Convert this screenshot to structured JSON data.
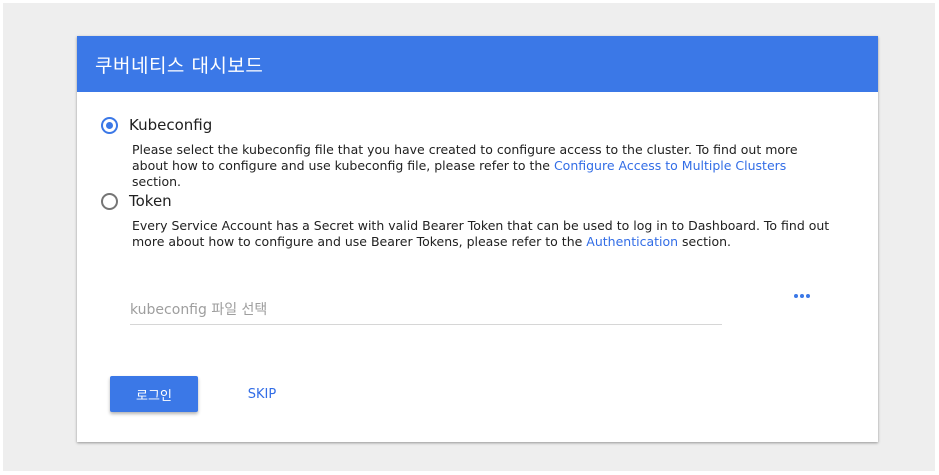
{
  "header": {
    "title": "쿠버네티스 대시보드"
  },
  "options": {
    "kubeconfig": {
      "label": "Kubeconfig",
      "selected": true,
      "desc_before": "Please select the kubeconfig file that you have created to configure access to the cluster. To find out more about how to configure and use kubeconfig file, please refer to the ",
      "link_text": "Configure Access to Multiple Clusters",
      "desc_after": " section."
    },
    "token": {
      "label": "Token",
      "selected": false,
      "desc_before": "Every Service Account has a Secret with valid Bearer Token that can be used to log in to Dashboard. To find out more about how to configure and use Bearer Tokens, please refer to the ",
      "link_text": "Authentication",
      "desc_after": " section."
    }
  },
  "file_picker": {
    "placeholder": "kubeconfig 파일 선택",
    "value": "",
    "browse_icon": "more-horiz-icon"
  },
  "actions": {
    "login_label": "로그인",
    "skip_label": "SKIP"
  },
  "colors": {
    "accent": "#3b78e7",
    "link": "#326de6",
    "background": "#eeeeee"
  }
}
